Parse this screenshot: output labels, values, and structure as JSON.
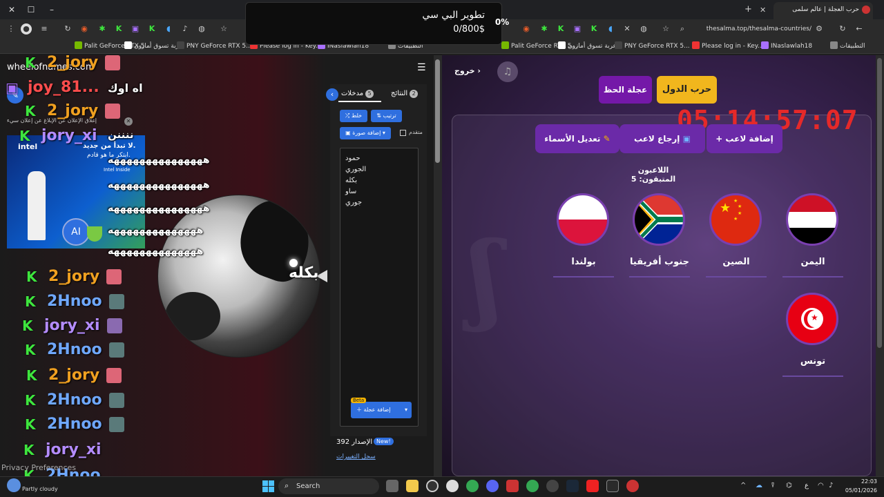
{
  "left_window": {
    "bookmarks": [
      "Palit GeForce RTX 5...",
      "عربة تسوق أمازون",
      "PNY GeForce RTX 5...",
      "Please log in - Key...",
      "INaslawlah18",
      "التطبيقات"
    ],
    "wheel_logo": "wheelofnames.com",
    "ad_close_text": "إغلاق الإعلان عن الإبلاغ عن إعلان سيء",
    "wheel_panel": {
      "tab_entries": "مدخلات",
      "tab_entries_count": "5",
      "tab_results": "النتائج",
      "tab_results_count": "2",
      "shuffle_label": "خلط",
      "sort_label": "ترتيب",
      "add_image_label": "إضافة صورة",
      "advanced_label": "متقدم",
      "entries": [
        "حمود",
        "الجوري",
        "بكله",
        "ساو",
        "جوري"
      ],
      "add_wheel_label": "إضافة عجلة",
      "beta_label": "Beta",
      "version_label": "الإصدار 392",
      "new_label": "New!",
      "changelog_label": "سجل التغييرات"
    },
    "wheel_winner_label": "بكله",
    "chat": [
      {
        "name": "2_jory",
        "color": "#f0a020"
      },
      {
        "name": "joy_81...",
        "color": "#ff4d4d",
        "message": "اه اوك"
      },
      {
        "name": "2_jory",
        "color": "#f0a020"
      },
      {
        "name": "jory_xi",
        "color": "#b48cff",
        "message": "ننننن"
      },
      {
        "name": "2_jory",
        "color": "#f0a020"
      },
      {
        "name": "2Hnoo",
        "color": "#6fa8ff"
      },
      {
        "name": "jory_xi",
        "color": "#b48cff"
      },
      {
        "name": "2Hnoo",
        "color": "#6fa8ff"
      },
      {
        "name": "2_jory",
        "color": "#f0a020"
      },
      {
        "name": "2Hnoo",
        "color": "#6fa8ff"
      },
      {
        "name": "2Hnoo",
        "color": "#6fa8ff"
      },
      {
        "name": "jory_xi",
        "color": "#b48cff"
      },
      {
        "name": "2Hnoo",
        "color": "#6fa8ff"
      }
    ],
    "spam_messages": [
      "هههههههههههههههه",
      "هههههههههههههههه",
      "هههههههههههههههه",
      "ههههههههههههههه",
      "ههههههههههههههه"
    ],
    "ad_text": {
      "headline": "لا تبدأ من جديد.",
      "line2": "ابتكر ما هو قادم.",
      "brand": "intel",
      "tagline": "Intel Inside",
      "ai_label": "AI"
    },
    "privacy_label": "Privacy Preferences"
  },
  "download_overlay": {
    "percent": "0%",
    "title": "تطوير البي سي",
    "amount": "0/800$"
  },
  "right_window": {
    "tab_title": "حرب العجلة | عالم سلمى",
    "url": "thesalma.top/thesalma-countries/",
    "bookmarks": [
      "Palit GeForce RTX 5...",
      "عربة تسوق أمازون",
      "PNY GeForce RTX 5...",
      "Please log in - Key...",
      "INaslawlah18",
      "التطبيقات"
    ],
    "exit_label": "خروج",
    "mode_active": "حرب الدول",
    "mode_other": "عجلة الحظ",
    "timer": "05:14:57:07",
    "buttons": {
      "add_player": "+ إضافة لاعب",
      "return_player": "إرجاع لاعب",
      "edit_names": "تعديل الأسماء"
    },
    "players_remaining": "اللاعبون المتبقون: 5",
    "countries": [
      {
        "name": "اليمن",
        "flag": "yemen-flag"
      },
      {
        "name": "الصين",
        "flag": "china-flag"
      },
      {
        "name": "جنوب أفريقيا",
        "flag": "south-africa-flag"
      },
      {
        "name": "بولندا",
        "flag": "poland-flag"
      },
      {
        "name": "تونس",
        "flag": "tunisia-flag"
      }
    ],
    "colors": {
      "accent_gold": "#f1b61d",
      "accent_purple": "#6b2aa8",
      "timer_red": "#e52929"
    }
  },
  "taskbar": {
    "weather": "Partly cloudy",
    "search_label": "Search",
    "time": "22:03",
    "date": "05/01/2026",
    "lang": "ع"
  }
}
